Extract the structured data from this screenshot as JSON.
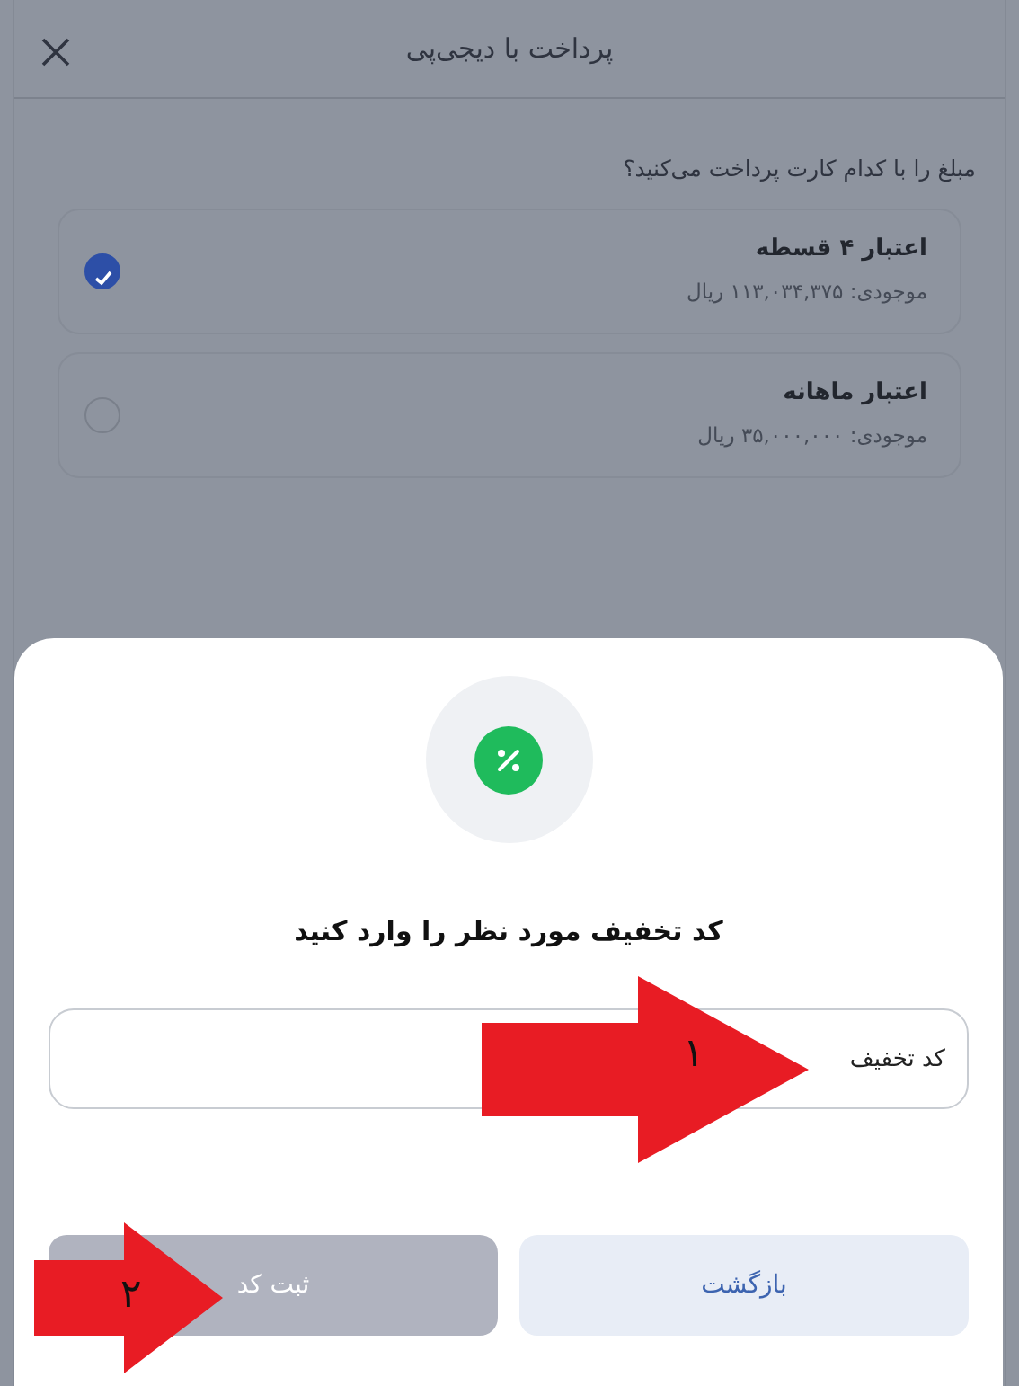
{
  "dialog": {
    "title": "پرداخت با دیجی‌پی",
    "question": "مبلغ را با کدام کارت پرداخت می‌کنید؟",
    "cards": [
      {
        "name": "اعتبار ۴ قسطه",
        "balance": "موجودی: ۱۱۳,۰۳۴,۳۷۵ ریال",
        "selected": true
      },
      {
        "name": "اعتبار ماهانه",
        "balance": "موجودی: ۳۵,۰۰۰,۰۰۰ ریال",
        "selected": false
      }
    ]
  },
  "sheet": {
    "title": "کد تخفیف مورد نظر را وارد کنید",
    "field": {
      "placeholder": "کد تخفیف"
    },
    "buttons": [
      {
        "label": "بازگشت",
        "kind": "secondary",
        "disabled": false
      },
      {
        "label": "ثبت کد",
        "kind": "primary",
        "disabled": true
      }
    ]
  },
  "annotations": [
    {
      "number": "۱"
    },
    {
      "number": "۲"
    }
  ]
}
